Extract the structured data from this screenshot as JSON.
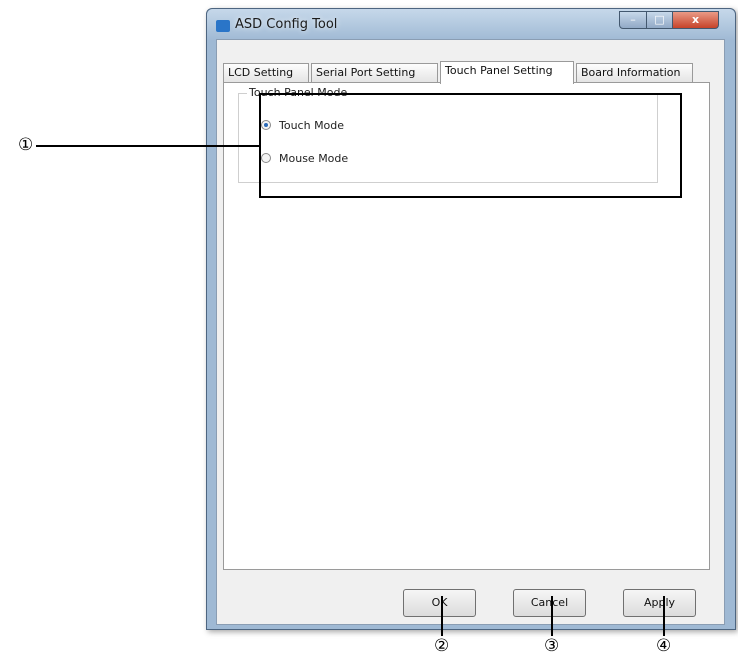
{
  "window": {
    "title": "ASD Config Tool",
    "controls": {
      "minimize": "–",
      "maximize": "□",
      "close": "x"
    }
  },
  "tabs": [
    {
      "label": "LCD Setting",
      "active": false
    },
    {
      "label": "Serial Port Setting",
      "active": false
    },
    {
      "label": "Touch Panel Setting",
      "active": true
    },
    {
      "label": "Board Information",
      "active": false
    }
  ],
  "group": {
    "label": "Touch Panel Mode",
    "options": [
      {
        "label": "Touch Mode",
        "selected": true
      },
      {
        "label": "Mouse Mode",
        "selected": false
      }
    ]
  },
  "buttons": {
    "ok": "OK",
    "cancel": "Cancel",
    "apply": "Apply"
  },
  "callouts": {
    "c1": "①",
    "c2": "②",
    "c3": "③",
    "c4": "④"
  },
  "colors": {
    "selected_radio": "#2b6ab8",
    "close_button": "#c7432a"
  }
}
